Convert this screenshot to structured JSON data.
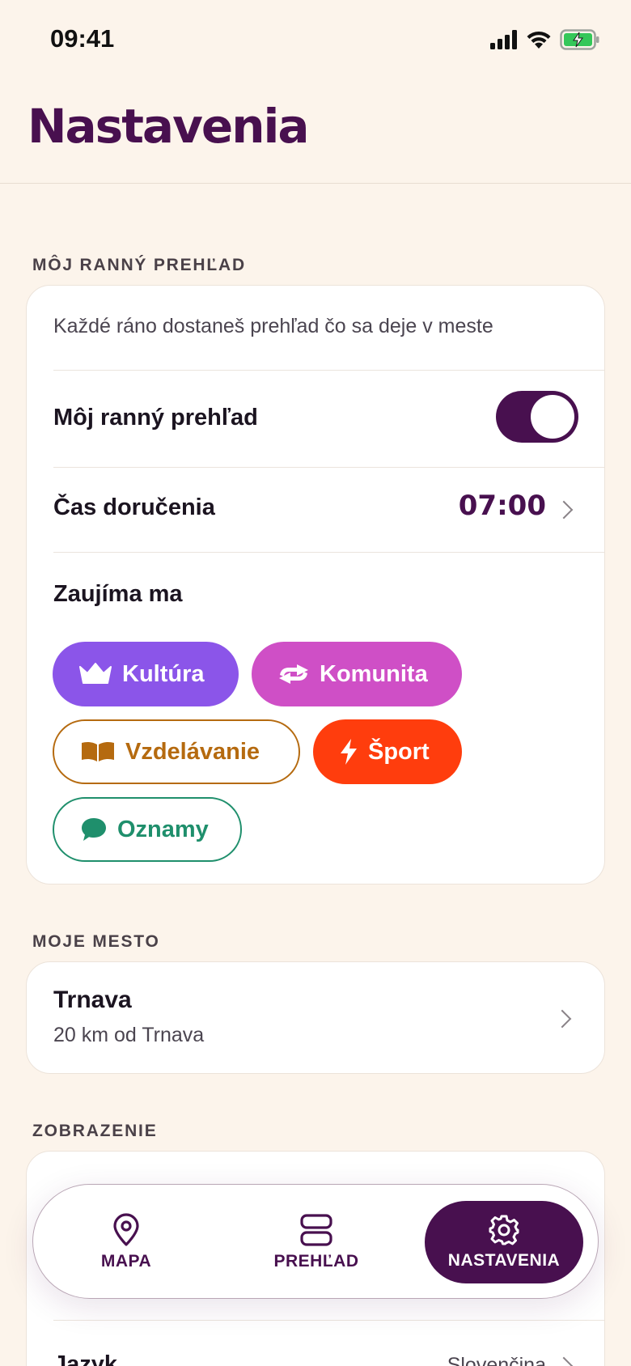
{
  "status": {
    "time": "09:41"
  },
  "header": {
    "title": "Nastavenia"
  },
  "morning": {
    "section_label": "MÔJ RANNÝ PREHĽAD",
    "description": "Každé ráno dostaneš prehľad čo sa deje v meste",
    "toggle_label": "Môj ranný prehľad",
    "toggle_on": true,
    "delivery_label": "Čas doručenia",
    "delivery_time": "07:00",
    "interests_label": "Zaujíma ma",
    "chips": [
      {
        "label": "Kultúra",
        "icon": "crown-icon",
        "color": "#8b55e9",
        "selected": true
      },
      {
        "label": "Komunita",
        "icon": "arrows-icon",
        "color": "#cf4fc6",
        "selected": true
      },
      {
        "label": "Vzdelávanie",
        "icon": "book-icon",
        "color": "#b56a0f",
        "selected": false
      },
      {
        "label": "Šport",
        "icon": "bolt-icon",
        "color": "#ff3d0d",
        "selected": true
      },
      {
        "label": "Oznamy",
        "icon": "chat-bubble-icon",
        "color": "#1f8f6c",
        "selected": false
      }
    ]
  },
  "city": {
    "section_label": "MOJE MESTO",
    "name": "Trnava",
    "distance": "20 km od Trnava"
  },
  "display": {
    "section_label": "ZOBRAZENIE",
    "language_label": "Jazyk",
    "language_value": "Slovenčina"
  },
  "tabs": [
    {
      "label": "MAPA",
      "icon": "map-pin-icon",
      "active": false
    },
    {
      "label": "PREHĽAD",
      "icon": "list-icon",
      "active": false
    },
    {
      "label": "NASTAVENIA",
      "icon": "gear-icon",
      "active": true
    }
  ],
  "colors": {
    "brand": "#48104f",
    "background": "#fcf4eb"
  }
}
